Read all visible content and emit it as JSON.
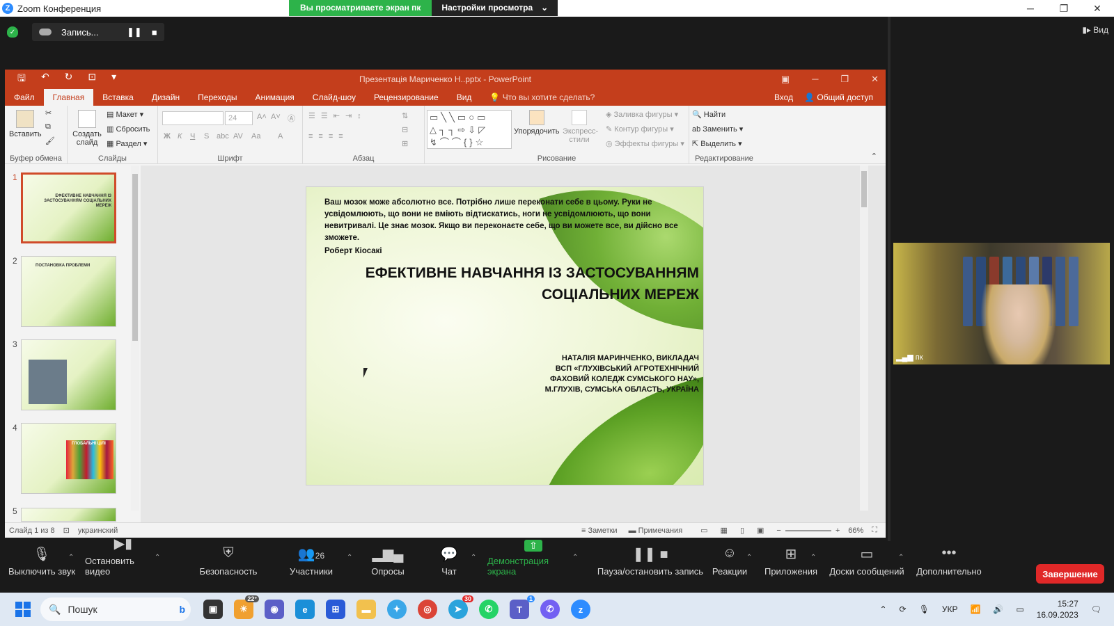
{
  "window": {
    "title": "Zoom Конференция",
    "logo": "Z"
  },
  "share_banner": {
    "status": "Вы просматриваете экран пк",
    "settings": "Настройки просмотра"
  },
  "recording": {
    "label": "Запись..."
  },
  "view_button": "Вид",
  "ppt": {
    "title": "Презентація Мариченко Н..pptx - PowerPoint",
    "tabs": [
      "Файл",
      "Главная",
      "Вставка",
      "Дизайн",
      "Переходы",
      "Анимация",
      "Слайд-шоу",
      "Рецензирование",
      "Вид"
    ],
    "tell_me": "Что вы хотите сделать?",
    "signin": "Вход",
    "share": "Общий доступ",
    "ribbon": {
      "paste": "Вставить",
      "create_slide": "Создать слайд",
      "layout": "Макет",
      "reset": "Сбросить",
      "section": "Раздел",
      "font_size": "24",
      "arrange": "Упорядочить",
      "quick_styles": "Экспресс-стили",
      "shape_fill": "Заливка фигуры",
      "shape_outline": "Контур фигуры",
      "shape_effects": "Эффекты фигуры",
      "find": "Найти",
      "replace": "Заменить",
      "select": "Выделить",
      "groups": {
        "clipboard": "Буфер обмена",
        "slides": "Слайды",
        "font": "Шрифт",
        "paragraph": "Абзац",
        "drawing": "Рисование",
        "editing": "Редактирование"
      }
    },
    "thumbnails": [
      {
        "num": "1",
        "text": "ЕФЕКТИВНЕ НАВЧАННЯ ІЗ ЗАСТОСУВАННЯМ СОЦІАЛЬНИХ МЕРЕЖ"
      },
      {
        "num": "2",
        "text": "ПОСТАНОВКА ПРОБЛЕМИ"
      },
      {
        "num": "3",
        "text": ""
      },
      {
        "num": "4",
        "text": "ГЛОБАЛЬНІ ЦІЛІ"
      },
      {
        "num": "5",
        "text": ""
      }
    ],
    "slide": {
      "quote": "Ваш мозок може абсолютно все. Потрібно лише переконати себе в цьому. Руки не усвідомлюють, що вони не вміють відтискатись, ноги не усвідомлюють, що вони невитривалі. Це знає мозок. Якщо ви переконаєте себе, що ви можете все, ви дійсно все зможете.",
      "author": "Роберт Кіосакі",
      "title_line1": "ЕФЕКТИВНЕ НАВЧАННЯ ІЗ ЗАСТОСУВАННЯМ",
      "title_line2": "СОЦІАЛЬНИХ МЕРЕЖ",
      "presenter": [
        "НАТАЛІЯ МАРИНЧЕНКО, ВИКЛАДАЧ",
        "ВСП «ГЛУХІВСЬКИЙ АГРОТЕХНІЧНИЙ",
        "ФАХОВИЙ КОЛЕДЖ СУМСЬКОГО НАУ»,",
        "М.ГЛУХІВ, СУМСЬКА ОБЛАСТЬ, УКРАЇНА"
      ]
    },
    "status": {
      "slide": "Слайд 1 из 8",
      "language": "украинский",
      "notes": "Заметки",
      "comments": "Примечания",
      "zoom": "66%"
    }
  },
  "participant_video": {
    "label": "пк"
  },
  "toolbar": {
    "mute": "Выключить звук",
    "stop_video": "Остановить видео",
    "security": "Безопасность",
    "participants": "Участники",
    "participants_count": "26",
    "polls": "Опросы",
    "chat": "Чат",
    "share": "Демонстрация экрана",
    "record": "Пауза/остановить запись",
    "reactions": "Реакции",
    "apps": "Приложения",
    "whiteboards": "Доски сообщений",
    "more": "Дополнительно",
    "end": "Завершение"
  },
  "taskbar": {
    "search": "Пошук",
    "weather": "22°",
    "badge_telegram": "30",
    "badge_teams": "1",
    "lang": "УКР",
    "time": "15:27",
    "date": "16.09.2023"
  },
  "colors": {
    "ppt_accent": "#c43e1c",
    "zoom_green": "#2db34a",
    "end_red": "#e02828",
    "zoom_blue": "#2d8cff"
  }
}
